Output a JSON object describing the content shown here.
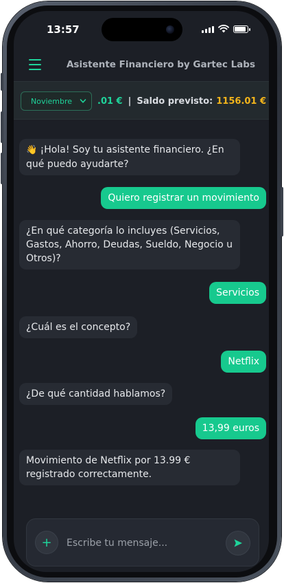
{
  "status_bar": {
    "time": "13:57"
  },
  "header": {
    "title": "Asistente Financiero by Gartec Labs",
    "menu_icon": "hamburger-menu-icon"
  },
  "balance": {
    "month_selected": "Noviembre",
    "current_amount_partial": ".01 €",
    "separator": "|",
    "forecast_label": "Saldo previsto:",
    "forecast_amount": "1156.01 €",
    "trailing": "|"
  },
  "messages": [
    {
      "sender": "bot",
      "emoji": "👋",
      "text": "¡Hola! Soy tu asistente financiero. ¿En qué puedo ayudarte?"
    },
    {
      "sender": "user",
      "text": "Quiero registrar un movimiento"
    },
    {
      "sender": "bot",
      "text": "¿En qué categoría lo incluyes (Servicios, Gastos, Ahorro, Deudas, Sueldo, Negocio u Otros)?"
    },
    {
      "sender": "user",
      "text": "Servicios"
    },
    {
      "sender": "bot",
      "text": "¿Cuál es el concepto?"
    },
    {
      "sender": "user",
      "text": "Netflix"
    },
    {
      "sender": "bot",
      "text": "¿De qué cantidad hablamos?"
    },
    {
      "sender": "user",
      "text": "13,99 euros"
    },
    {
      "sender": "bot",
      "text": "Movimiento de Netflix por 13.99 € registrado correctamente."
    }
  ],
  "composer": {
    "placeholder": "Escribe tu mensaje...",
    "attach_label": "+"
  },
  "colors": {
    "accent": "#1fd39a",
    "user_bubble": "#17c98e",
    "forecast": "#f2b41b",
    "background": "#1c1f26"
  }
}
